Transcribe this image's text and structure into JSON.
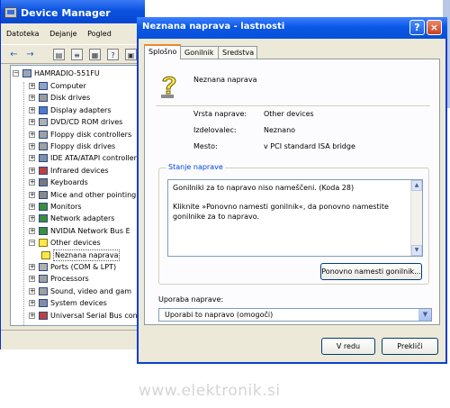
{
  "device_manager": {
    "title": "Device Manager",
    "menu": [
      "Datoteka",
      "Dejanje",
      "Pogled"
    ],
    "tree": {
      "root": "HAMRADIO-551FU",
      "items": [
        "Computer",
        "Disk drives",
        "Display adapters",
        "DVD/CD ROM drives",
        "Floppy disk controllers",
        "Floppy disk drives",
        "IDE ATA/ATAPI controllers",
        "Infrared devices",
        "Keyboards",
        "Mice and other pointing",
        "Monitors",
        "Network adapters",
        "NVIDIA Network Bus E",
        "Other devices"
      ],
      "child": "Neznana naprava",
      "items_after": [
        "Ports (COM & LPT)",
        "Processors",
        "Sound, video and gam",
        "System devices",
        "Universal Serial Bus con"
      ]
    }
  },
  "dialog": {
    "title": "Neznana naprava - lastnosti",
    "help_glyph": "?",
    "close_glyph": "×",
    "tabs": [
      "Splošno",
      "Gonilnik",
      "Sredstva"
    ],
    "device_name": "Neznana naprava",
    "fields": [
      {
        "key": "Vrsta naprave:",
        "value": "Other devices"
      },
      {
        "key": "Izdelovalec:",
        "value": "Neznano"
      },
      {
        "key": "Mesto:",
        "value": "v PCI standard ISA bridge"
      }
    ],
    "status_group": "Stanje naprave",
    "status_lines": [
      "Gonilniki za to napravo niso nameščeni. (Koda 28)",
      "Kliknite »Ponovno namesti gonilnik«, da ponovno namestite",
      "gonilnike za to napravo."
    ],
    "reinstall_button": "Ponovno namesti gonilnik...",
    "usage_label": "Uporaba naprave:",
    "usage_value": "Uporabi to napravo (omogoči)",
    "ok_button": "V redu",
    "cancel_button": "Prekliči"
  },
  "watermark": "www.elektronik.si",
  "colors": {
    "title_bar": "#0b58e6",
    "dialog_face": "#ece9d8",
    "group_caption": "#0046d5",
    "warning_icon": "#ffe84a"
  }
}
